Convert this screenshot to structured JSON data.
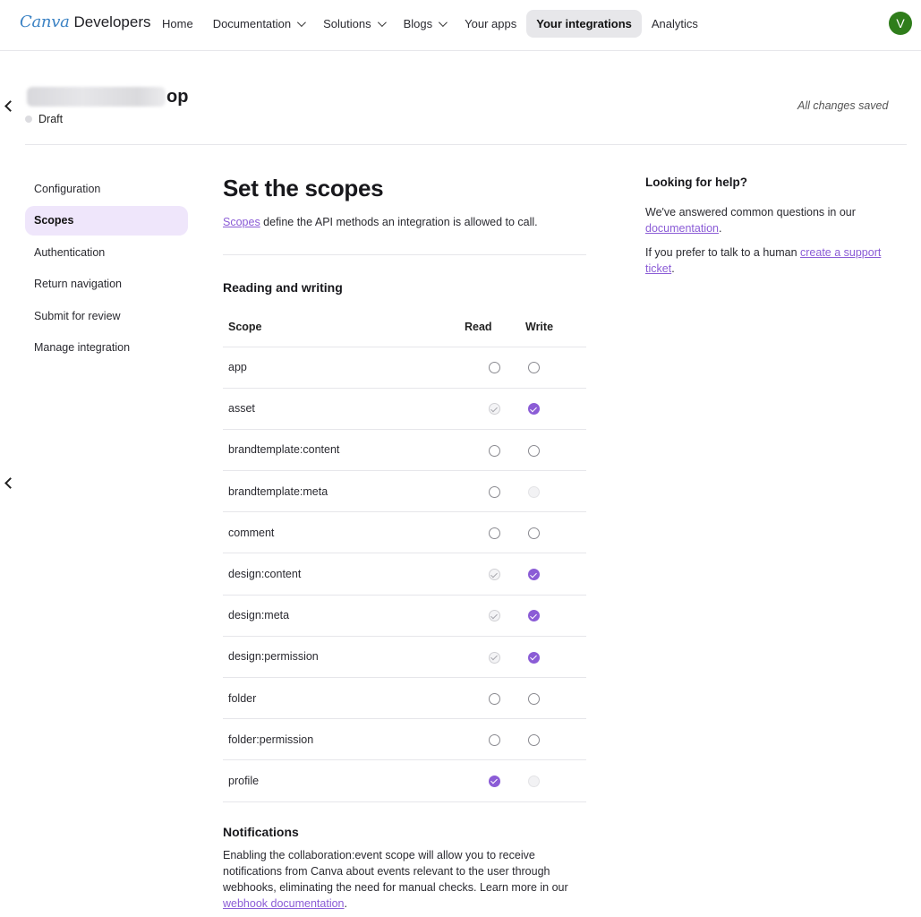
{
  "nav": {
    "brand_canva": "Canva",
    "brand_developers": "Developers",
    "items": [
      {
        "label": "Home"
      },
      {
        "label": "Documentation"
      },
      {
        "label": "Solutions"
      },
      {
        "label": "Blogs"
      },
      {
        "label": "Your apps"
      },
      {
        "label": "Your integrations"
      },
      {
        "label": "Analytics"
      }
    ],
    "avatar_initial": "V"
  },
  "header": {
    "title_suffix": "op",
    "status": "Draft",
    "saved_text": "All changes saved"
  },
  "sidenav": {
    "items": [
      {
        "label": "Configuration"
      },
      {
        "label": "Scopes"
      },
      {
        "label": "Authentication"
      },
      {
        "label": "Return navigation"
      },
      {
        "label": "Submit for review"
      },
      {
        "label": "Manage integration"
      }
    ]
  },
  "main": {
    "title": "Set the scopes",
    "intro_link": "Scopes",
    "intro_text": " define the API methods an integration is allowed to call.",
    "section_title": "Reading and writing",
    "columns": {
      "scope": "Scope",
      "read": "Read",
      "write": "Write"
    },
    "scopes": [
      {
        "name": "app",
        "read": "unchecked",
        "write": "unchecked"
      },
      {
        "name": "asset",
        "read": "locked",
        "write": "checked"
      },
      {
        "name": "brandtemplate:content",
        "read": "unchecked",
        "write": "unchecked"
      },
      {
        "name": "brandtemplate:meta",
        "read": "unchecked",
        "write": "disabled"
      },
      {
        "name": "comment",
        "read": "unchecked",
        "write": "unchecked"
      },
      {
        "name": "design:content",
        "read": "locked",
        "write": "checked"
      },
      {
        "name": "design:meta",
        "read": "locked",
        "write": "checked"
      },
      {
        "name": "design:permission",
        "read": "locked",
        "write": "checked"
      },
      {
        "name": "folder",
        "read": "unchecked",
        "write": "unchecked"
      },
      {
        "name": "folder:permission",
        "read": "unchecked",
        "write": "unchecked"
      },
      {
        "name": "profile",
        "read": "checked",
        "write": "disabled"
      }
    ],
    "notifications": {
      "title": "Notifications",
      "text": "Enabling the collaboration:event scope will allow you to receive notifications from Canva about events relevant to the user through webhooks, eliminating the need for manual checks. Learn more in our ",
      "link": "webhook documentation",
      "end": "."
    }
  },
  "help": {
    "title": "Looking for help?",
    "p1_text": "We've answered common questions in our ",
    "p1_link": "documentation",
    "p1_end": ".",
    "p2_text": "If you prefer to talk to a human ",
    "p2_link": "create a support ticket",
    "p2_end": "."
  },
  "colors": {
    "accent": "#8b5cd6",
    "avatar": "#2f7d1b",
    "active_side": "#efe6fb"
  }
}
